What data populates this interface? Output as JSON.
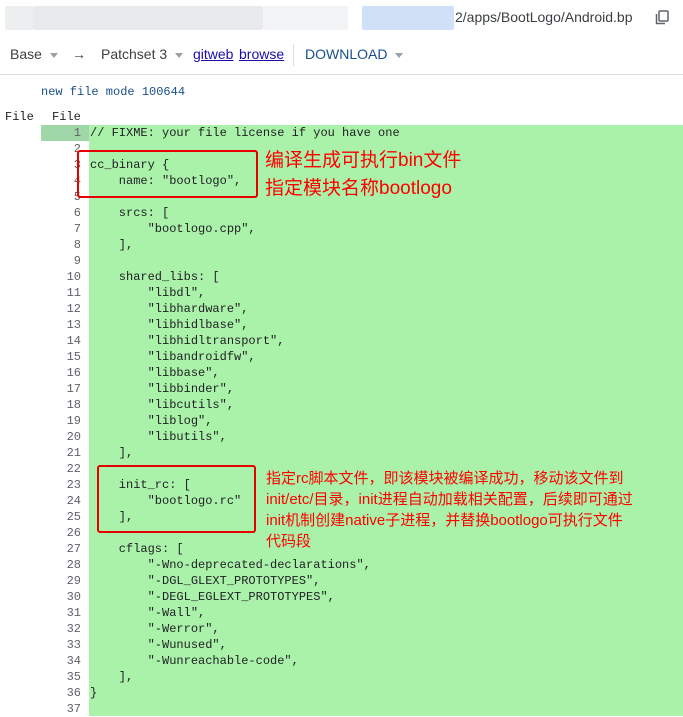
{
  "path_bar": {
    "path_suffix": "2/apps/BootLogo/Android.bp"
  },
  "toolbar": {
    "base_label": "Base",
    "arrow": "→",
    "patchset_label": "Patchset 3",
    "gitweb_label": "gitweb",
    "browse_label": "browse",
    "download_label": "DOWNLOAD"
  },
  "diff": {
    "mode_line": "new file mode 100644",
    "col_left": "File",
    "col_right": "File",
    "lines": [
      "// FIXME: your file license if you have one",
      "",
      "cc_binary {",
      "    name: \"bootlogo\",",
      "",
      "    srcs: [",
      "        \"bootlogo.cpp\",",
      "    ],",
      "",
      "    shared_libs: [",
      "        \"libdl\",",
      "        \"libhardware\",",
      "        \"libhidlbase\",",
      "        \"libhidltransport\",",
      "        \"libandroidfw\",",
      "        \"libbase\",",
      "        \"libbinder\",",
      "        \"libcutils\",",
      "        \"liblog\",",
      "        \"libutils\",",
      "    ],",
      "",
      "    init_rc: [",
      "        \"bootlogo.rc\"",
      "    ],",
      "",
      "    cflags: [",
      "        \"-Wno-deprecated-declarations\",",
      "        \"-DGL_GLEXT_PROTOTYPES\",",
      "        \"-DEGL_EGLEXT_PROTOTYPES\",",
      "        \"-Wall\",",
      "        \"-Werror\",",
      "        \"-Wunused\",",
      "        \"-Wunreachable-code\",",
      "    ],",
      "}",
      ""
    ]
  },
  "annotations": {
    "note1_line1": "编译生成可执行bin文件",
    "note1_line2": "指定模块名称bootlogo",
    "note2_line1": "指定rc脚本文件，即该模块被编译成功，移动该文件到",
    "note2_line2": "init/etc/目录，init进程自动加载相关配置，后续即可通过",
    "note2_line3": "init机制创建native子进程，并替换bootlogo可执行文件",
    "note2_line4": "代码段"
  },
  "colors": {
    "added_bg": "#aaf2aa",
    "annotation_red": "#ff0000",
    "link_blue": "#1a0dab"
  }
}
